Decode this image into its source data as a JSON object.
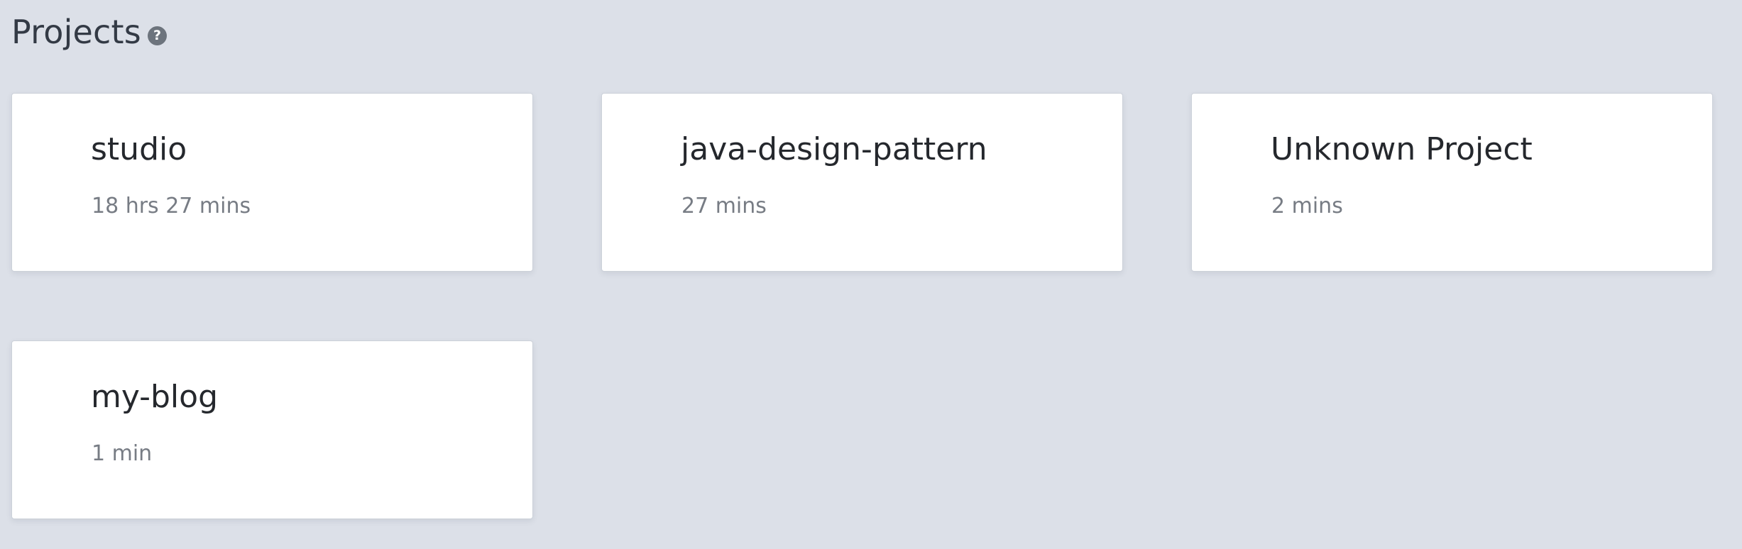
{
  "header": {
    "title": "Projects",
    "help_icon": "question-circle-icon",
    "help_glyph": "?"
  },
  "projects": [
    {
      "name": "studio",
      "time": "18 hrs 27 mins"
    },
    {
      "name": "java-design-pattern",
      "time": "27 mins"
    },
    {
      "name": "Unknown Project",
      "time": "2 mins"
    },
    {
      "name": "my-blog",
      "time": "1 min"
    }
  ],
  "colors": {
    "background": "#dce0e8",
    "card": "#ffffff",
    "title_text": "#333a45",
    "name_text": "#25282d",
    "time_text": "#777c84"
  }
}
